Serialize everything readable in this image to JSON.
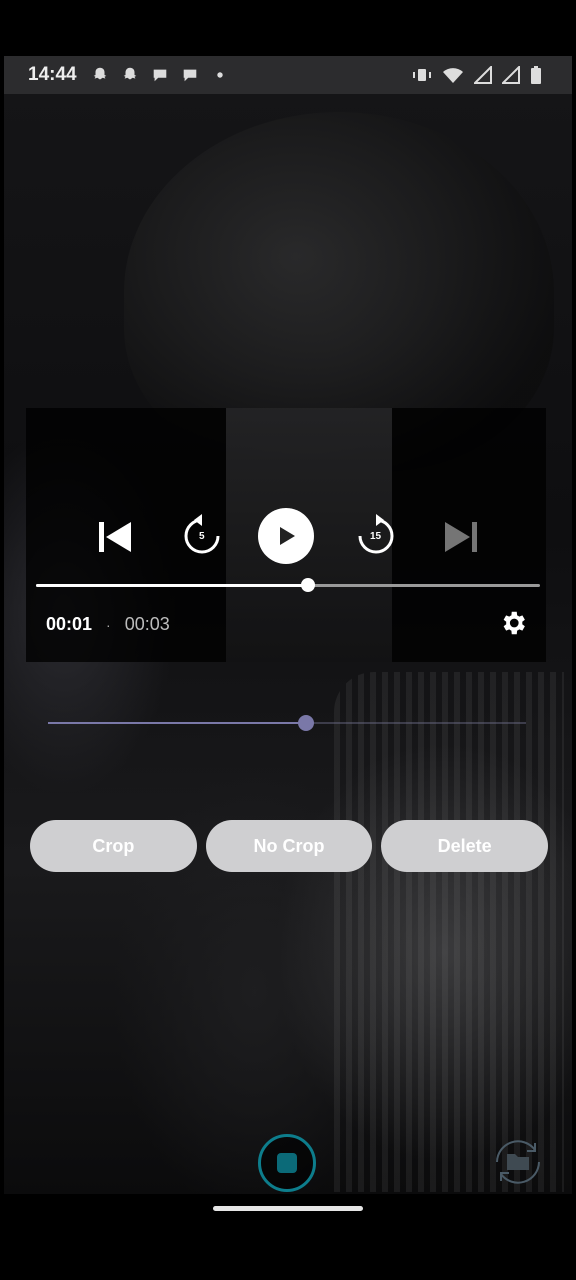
{
  "status_bar": {
    "time": "14:44",
    "notification_icons": [
      "snapchat-icon",
      "snapchat-icon",
      "chat-icon",
      "chat-icon",
      "dot-icon"
    ],
    "system_icons": [
      "vibrate-icon",
      "wifi-icon",
      "signal-icon",
      "signal-icon",
      "battery-icon"
    ]
  },
  "player": {
    "current_time": "00:01",
    "separator": "·",
    "duration": "00:03",
    "progress": 0.54,
    "rewind_seconds": "5",
    "forward_seconds": "15",
    "next_enabled": false
  },
  "trim_slider": {
    "value": 0.54
  },
  "actions": {
    "crop_label": "Crop",
    "no_crop_label": "No Crop",
    "delete_label": "Delete"
  },
  "bottom_bar": {
    "record_icon": "stop-record-icon",
    "gallery_icon": "folder-switch-icon"
  },
  "colors": {
    "accent": "#0d7d8c",
    "slider": "#7a78a8",
    "pill": "#cfcfd1"
  }
}
